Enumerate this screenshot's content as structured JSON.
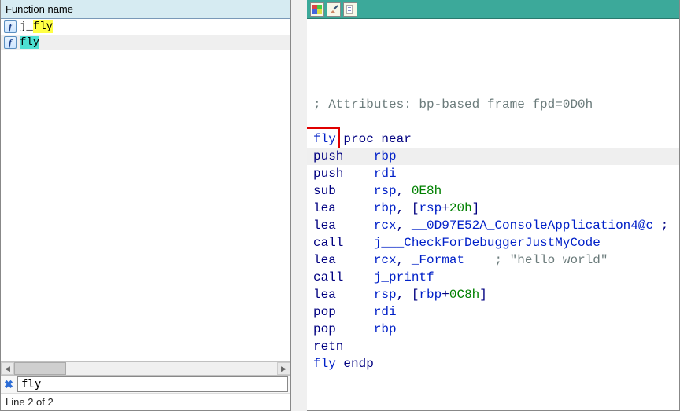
{
  "left": {
    "header": "Function name",
    "rows": [
      {
        "name_prefix": "j_",
        "name_hl": "fly",
        "hl_class": "hl-yellow",
        "selected": false
      },
      {
        "name_prefix": "",
        "name_hl": "fly",
        "hl_class": "hl-cyan",
        "selected": true
      }
    ],
    "search_value": "fly",
    "status": "Line 2 of 2"
  },
  "code": {
    "attrib_comment": "; Attributes: bp-based frame fpd=0D0h",
    "lines": [
      {
        "type": "blank"
      },
      {
        "type": "proc",
        "name": "fly",
        "rest": " proc near"
      },
      {
        "type": "instr_hl",
        "mnem": "push",
        "args": [
          {
            "t": "reg",
            "v": "rbp"
          }
        ]
      },
      {
        "type": "instr",
        "mnem": "push",
        "args": [
          {
            "t": "reg",
            "v": "rdi"
          }
        ]
      },
      {
        "type": "instr",
        "mnem": "sub",
        "args": [
          {
            "t": "reg",
            "v": "rsp"
          },
          {
            "t": "sep",
            "v": ", "
          },
          {
            "t": "num",
            "v": "0E8h"
          }
        ]
      },
      {
        "type": "instr",
        "mnem": "lea",
        "args": [
          {
            "t": "reg",
            "v": "rbp"
          },
          {
            "t": "sep",
            "v": ", ["
          },
          {
            "t": "reg",
            "v": "rsp"
          },
          {
            "t": "sep",
            "v": "+"
          },
          {
            "t": "num",
            "v": "20h"
          },
          {
            "t": "sep",
            "v": "]"
          }
        ]
      },
      {
        "type": "instr",
        "mnem": "lea",
        "args": [
          {
            "t": "reg",
            "v": "rcx"
          },
          {
            "t": "sep",
            "v": ", "
          },
          {
            "t": "sym",
            "v": "__0D97E52A_ConsoleApplication4@c"
          },
          {
            "t": "sep",
            "v": " ;"
          }
        ]
      },
      {
        "type": "instr",
        "mnem": "call",
        "args": [
          {
            "t": "sym",
            "v": "j___CheckForDebuggerJustMyCode"
          }
        ]
      },
      {
        "type": "instr",
        "mnem": "lea",
        "args": [
          {
            "t": "reg",
            "v": "rcx"
          },
          {
            "t": "sep",
            "v": ", "
          },
          {
            "t": "sym",
            "v": "_Format"
          },
          {
            "t": "sep",
            "v": "    "
          },
          {
            "t": "cmt",
            "v": "; \"hello world\""
          }
        ]
      },
      {
        "type": "instr",
        "mnem": "call",
        "args": [
          {
            "t": "sym",
            "v": "j_printf"
          }
        ]
      },
      {
        "type": "instr",
        "mnem": "lea",
        "args": [
          {
            "t": "reg",
            "v": "rsp"
          },
          {
            "t": "sep",
            "v": ", ["
          },
          {
            "t": "reg",
            "v": "rbp"
          },
          {
            "t": "sep",
            "v": "+"
          },
          {
            "t": "num",
            "v": "0C8h"
          },
          {
            "t": "sep",
            "v": "]"
          }
        ]
      },
      {
        "type": "instr",
        "mnem": "pop",
        "args": [
          {
            "t": "reg",
            "v": "rdi"
          }
        ]
      },
      {
        "type": "instr",
        "mnem": "pop",
        "args": [
          {
            "t": "reg",
            "v": "rbp"
          }
        ]
      },
      {
        "type": "instr",
        "mnem": "retn",
        "args": []
      },
      {
        "type": "endp",
        "name": "fly",
        "rest": " endp"
      }
    ]
  },
  "chart_data": null
}
